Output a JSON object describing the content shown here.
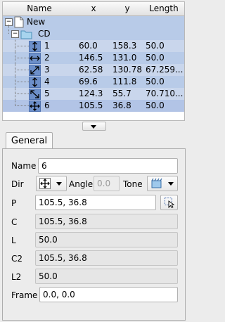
{
  "table": {
    "columns": [
      "Name",
      "x",
      "y",
      "Length"
    ],
    "root": {
      "label": "New",
      "expander": "−",
      "icon": "document-icon"
    },
    "group": {
      "label": "CD",
      "expander": "−",
      "icon": "folder-icon"
    },
    "rows": [
      {
        "name": "1",
        "x": "60.0",
        "y": "158.3",
        "length": "50.0",
        "icon": "vertical-arrow-icon"
      },
      {
        "name": "2",
        "x": "146.5",
        "y": "131.0",
        "length": "50.0",
        "icon": "horizontal-arrow-icon"
      },
      {
        "name": "3",
        "x": "62.58",
        "y": "130.78",
        "length": "67.259...",
        "icon": "diagonal-up-arrow-icon"
      },
      {
        "name": "4",
        "x": "69.6",
        "y": "111.8",
        "length": "50.0",
        "icon": "vertical-arrow-icon"
      },
      {
        "name": "5",
        "x": "124.3",
        "y": "55.7",
        "length": "70.710...",
        "icon": "diagonal-down-arrow-icon"
      },
      {
        "name": "6",
        "x": "105.5",
        "y": "36.8",
        "length": "50.0",
        "icon": "four-way-arrow-icon"
      }
    ]
  },
  "tab": {
    "label": "General"
  },
  "form": {
    "name_label": "Name",
    "name_value": "6",
    "dir_label": "Dir",
    "dir_icon": "four-way-arrow-icon",
    "angle_label": "Angle",
    "angle_value": "0.0",
    "tone_label": "Tone",
    "tone_icon": "tone-icon",
    "p_label": "P",
    "p_value": "105.5, 36.8",
    "c_label": "C",
    "c_value": "105.5, 36.8",
    "l_label": "L",
    "l_value": "50.0",
    "c2_label": "C2",
    "c2_value": "105.5, 36.8",
    "l2_label": "L2",
    "l2_value": "50.0",
    "frame_label": "Frame",
    "frame_value": "0.0, 0.0"
  },
  "colors": {
    "selection": "#b8cbe8",
    "icon_fill": "#6c8fc9"
  }
}
